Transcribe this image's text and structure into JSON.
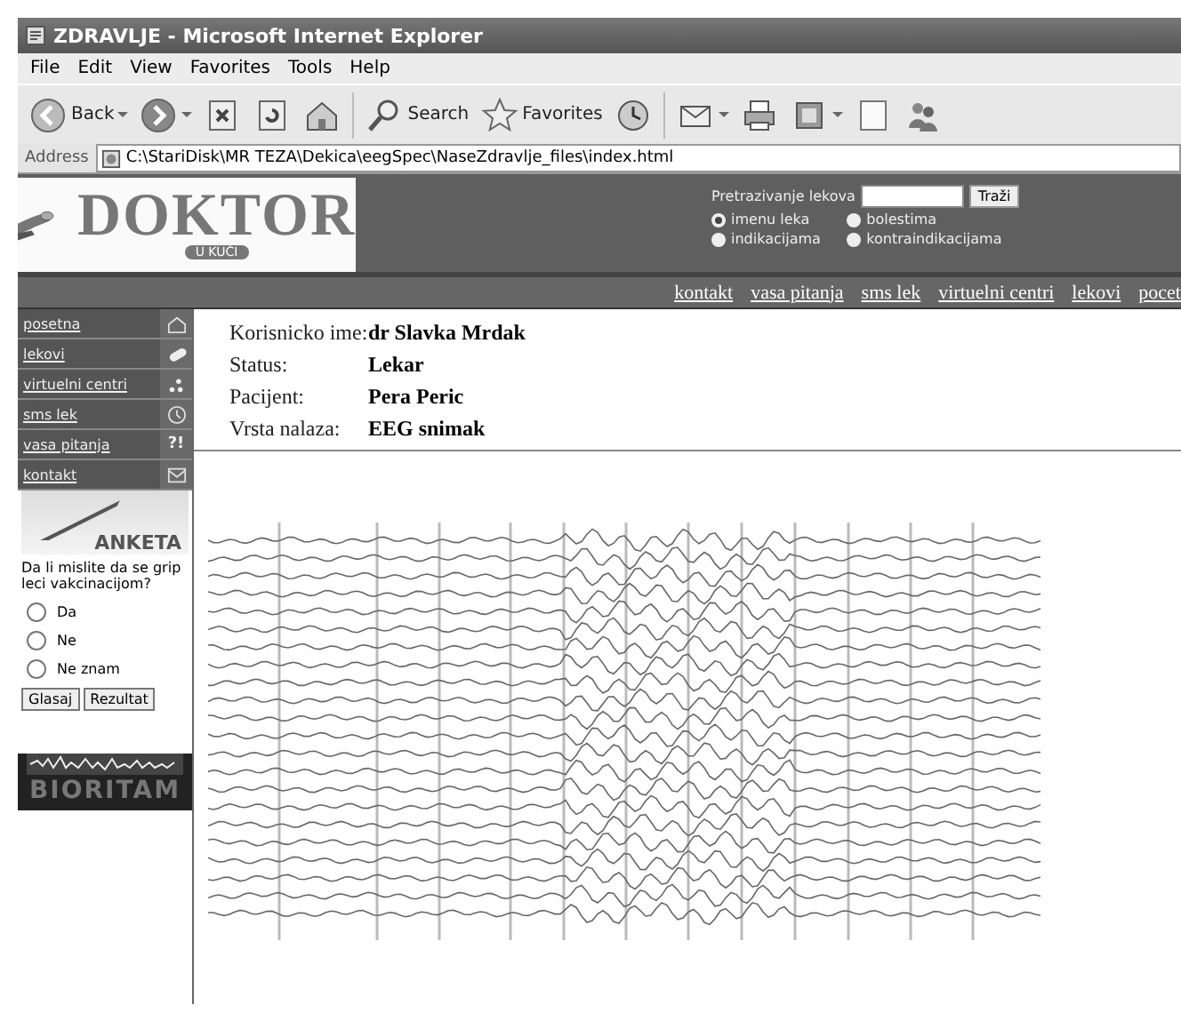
{
  "window": {
    "title": "ZDRAVLJE - Microsoft Internet Explorer"
  },
  "menu": [
    "File",
    "Edit",
    "View",
    "Favorites",
    "Tools",
    "Help"
  ],
  "toolbar": [
    {
      "kind": "back",
      "label": "Back",
      "dropdown": true
    },
    {
      "kind": "forward",
      "dropdown": true
    },
    {
      "kind": "stop"
    },
    {
      "kind": "refresh"
    },
    {
      "kind": "home"
    },
    {
      "kind": "search",
      "label": "Search"
    },
    {
      "kind": "favorites",
      "label": "Favorites"
    },
    {
      "kind": "history"
    },
    {
      "kind": "mail",
      "dropdown": true
    },
    {
      "kind": "print"
    },
    {
      "kind": "edit",
      "dropdown": true
    },
    {
      "kind": "discuss"
    },
    {
      "kind": "messenger"
    }
  ],
  "address": {
    "label": "Address",
    "value": "C:\\StariDisk\\MR TEZA\\Dekica\\eegSpec\\NaseZdravlje_files\\index.html"
  },
  "logo": {
    "title": "DOKTOR",
    "subtitle": "U KUĆI"
  },
  "search": {
    "label": "Pretrazivanje lekova",
    "button": "Traži",
    "options": [
      {
        "label": "imenu leka",
        "selected": true
      },
      {
        "label": "bolestima",
        "selected": false
      },
      {
        "label": "indikacijama",
        "selected": false
      },
      {
        "label": "kontraindikacijama",
        "selected": false
      }
    ]
  },
  "nav": [
    "kontakt",
    "vasa pitanja",
    "sms lek",
    "virtuelni centri",
    "lekovi",
    "pocet"
  ],
  "sidebar": {
    "items": [
      {
        "label": "posetna"
      },
      {
        "label": "lekovi"
      },
      {
        "label": "virtuelni centri"
      },
      {
        "label": "sms lek"
      },
      {
        "label": "vasa pitanja",
        "icon_text": "?!"
      },
      {
        "label": "kontakt"
      }
    ]
  },
  "poll": {
    "title": "ANKETA",
    "question": "Da li mislite da se grip leci vakcinacijom?",
    "options": [
      {
        "label": "Da",
        "selected": false
      },
      {
        "label": "Ne",
        "selected": false
      },
      {
        "label": "Ne znam",
        "selected": false
      }
    ],
    "buttons": [
      "Glasaj",
      "Rezultat"
    ]
  },
  "banner": {
    "title": "BIORITAM"
  },
  "info": [
    {
      "label": "Korisnicko ime:",
      "value": "dr Slavka Mrdak"
    },
    {
      "label": "Status:",
      "value": "Lekar"
    },
    {
      "label": "Pacijent:",
      "value": "Pera Peric"
    },
    {
      "label": "Vrsta nalaza:",
      "value": "EEG snimak"
    }
  ]
}
